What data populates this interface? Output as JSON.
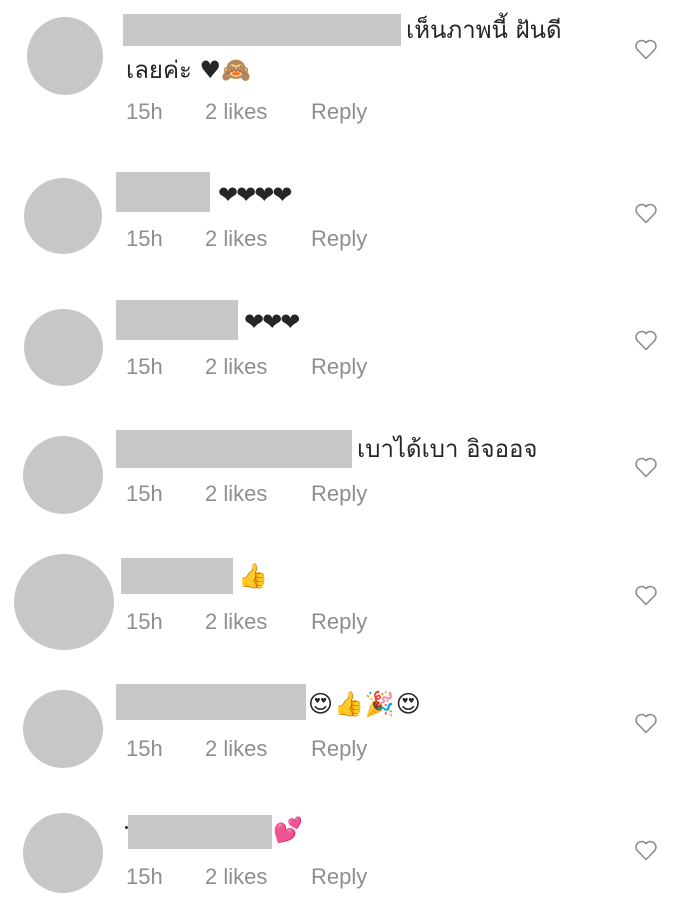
{
  "comments": [
    {
      "text_line1": "เห็นภาพนี้ ฝันดี",
      "text_line2": "เลยค่ะ ♥🙈",
      "time": "15h",
      "likes": "2 likes",
      "reply": "Reply",
      "like_icon": "heart-outline-icon"
    },
    {
      "text": "❤❤❤❤",
      "time": "15h",
      "likes": "2 likes",
      "reply": "Reply",
      "like_icon": "heart-outline-icon"
    },
    {
      "text": "❤❤❤",
      "time": "15h",
      "likes": "2 likes",
      "reply": "Reply",
      "like_icon": "heart-outline-icon"
    },
    {
      "text": "เบาได้เบา อิจออจ",
      "time": "15h",
      "likes": "2 likes",
      "reply": "Reply",
      "like_icon": "heart-outline-icon"
    },
    {
      "text": "👍",
      "time": "15h",
      "likes": "2 likes",
      "reply": "Reply",
      "like_icon": "heart-outline-icon"
    },
    {
      "text": "😍👍🎉😍",
      "time": "15h",
      "likes": "2 likes",
      "reply": "Reply",
      "like_icon": "heart-outline-icon"
    },
    {
      "text": "💕",
      "time": "15h",
      "likes": "2 likes",
      "reply": "Reply",
      "like_icon": "heart-outline-icon"
    }
  ],
  "colors": {
    "text": "#262626",
    "meta": "#8e8e8e",
    "redaction": "#c7c7c7",
    "heart_stroke": "#8e8e8e"
  }
}
